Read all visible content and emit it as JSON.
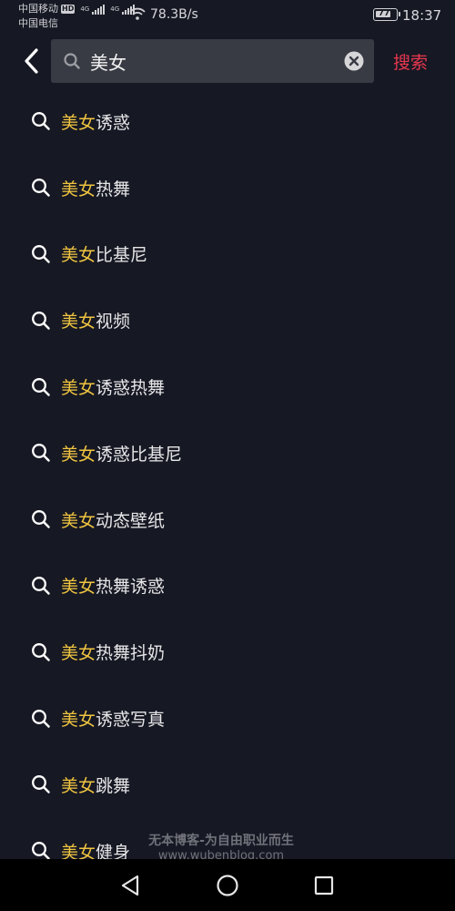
{
  "status_bar": {
    "carrier_1": "中国移动",
    "hd_label": "HD",
    "net_type": "4G",
    "carrier_2": "中国电信",
    "net_speed": "78.3B/s",
    "battery": "77",
    "time": "18:37"
  },
  "search": {
    "query": "美女",
    "submit_label": "搜索",
    "back_icon": "chevron-left-icon",
    "clear_icon": "clear-circle-icon"
  },
  "suggestions": [
    {
      "highlight": "美女",
      "rest": "诱惑"
    },
    {
      "highlight": "美女",
      "rest": "热舞"
    },
    {
      "highlight": "美女",
      "rest": "比基尼"
    },
    {
      "highlight": "美女",
      "rest": "视频"
    },
    {
      "highlight": "美女",
      "rest": "诱惑热舞"
    },
    {
      "highlight": "美女",
      "rest": "诱惑比基尼"
    },
    {
      "highlight": "美女",
      "rest": "动态壁纸"
    },
    {
      "highlight": "美女",
      "rest": "热舞诱惑"
    },
    {
      "highlight": "美女",
      "rest": "热舞抖奶"
    },
    {
      "highlight": "美女",
      "rest": "诱惑写真"
    },
    {
      "highlight": "美女",
      "rest": "跳舞"
    },
    {
      "highlight": "美女",
      "rest": "健身"
    }
  ],
  "watermark": {
    "line1": "无本博客-为自由职业而生",
    "line2": "www.wubenblog.com"
  },
  "colors": {
    "background": "#161823",
    "highlight": "#f0c540",
    "accent": "#e8374f",
    "search_box": "#393b44"
  }
}
